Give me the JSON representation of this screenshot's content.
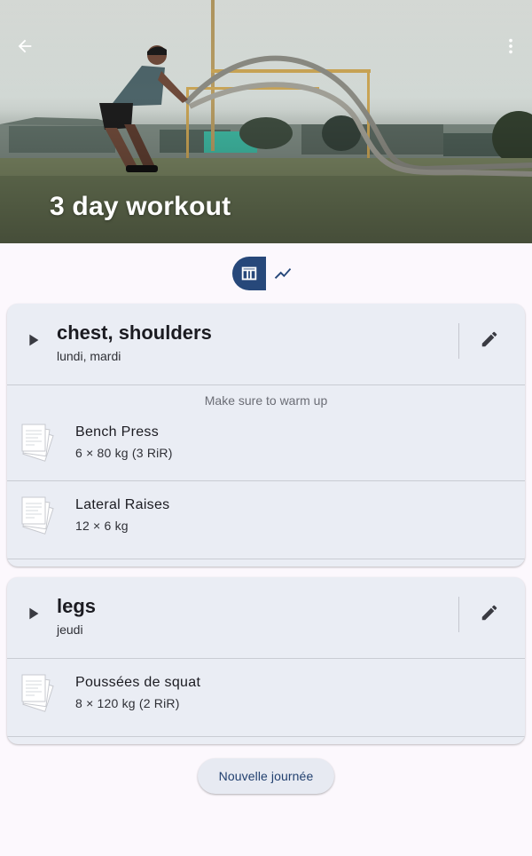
{
  "header": {
    "title": "3 day workout",
    "back_icon": "arrow-back-icon",
    "menu_icon": "more-vert-icon"
  },
  "view_toggle": {
    "selected": "table",
    "options": [
      "table-icon",
      "trend-icon"
    ]
  },
  "days": [
    {
      "name": "chest, shoulders",
      "days": "lundi, mardi",
      "note": "Make sure to warm up",
      "exercises": [
        {
          "name": "Bench Press",
          "detail": "6 × 80 kg  (3 RiR)"
        },
        {
          "name": "Lateral Raises",
          "detail": "12 × 6 kg"
        }
      ]
    },
    {
      "name": "legs",
      "days": "jeudi",
      "note": "",
      "exercises": [
        {
          "name": "Poussées de squat",
          "detail": "8 × 120 kg  (2 RiR)"
        }
      ]
    }
  ],
  "actions": {
    "new_day_label": "Nouvelle journée"
  },
  "colors": {
    "primary": "#27487a",
    "card_bg": "#eaedf4",
    "page_bg": "#fcf8fd"
  }
}
